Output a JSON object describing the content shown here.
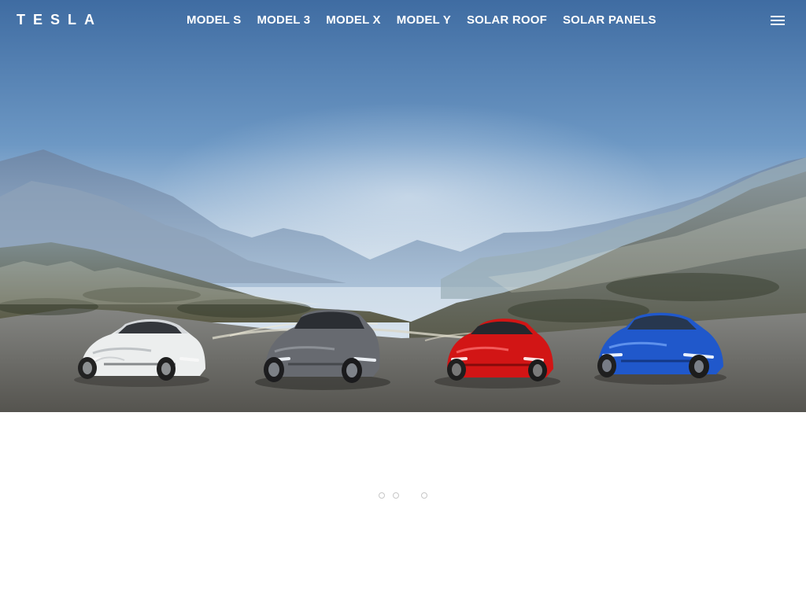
{
  "brand": {
    "logo_text": "TESLA"
  },
  "nav": {
    "items": [
      {
        "label": "MODEL S"
      },
      {
        "label": "MODEL 3"
      },
      {
        "label": "MODEL X"
      },
      {
        "label": "MODEL Y"
      },
      {
        "label": "SOLAR ROOF"
      },
      {
        "label": "SOLAR PANELS"
      }
    ],
    "menu_icon": "hamburger-menu-icon"
  },
  "hero": {
    "vehicles": [
      {
        "name": "white sedan",
        "color": "#e9eaea"
      },
      {
        "name": "gray suv",
        "color": "#6d6f74"
      },
      {
        "name": "red sedan",
        "color": "#c71414"
      },
      {
        "name": "blue crossover",
        "color": "#1f58c9"
      }
    ]
  },
  "carousel": {
    "dots": [
      {
        "state": "inactive"
      },
      {
        "state": "inactive"
      },
      {
        "state": "inactive"
      }
    ]
  },
  "colors": {
    "nav_text": "#ffffff",
    "sky_top": "#3e6aa0",
    "sky_mid": "#b7cbdd",
    "road": "#6f6e64",
    "dot_border": "#c7c7c7",
    "page_bg": "#ffffff"
  }
}
